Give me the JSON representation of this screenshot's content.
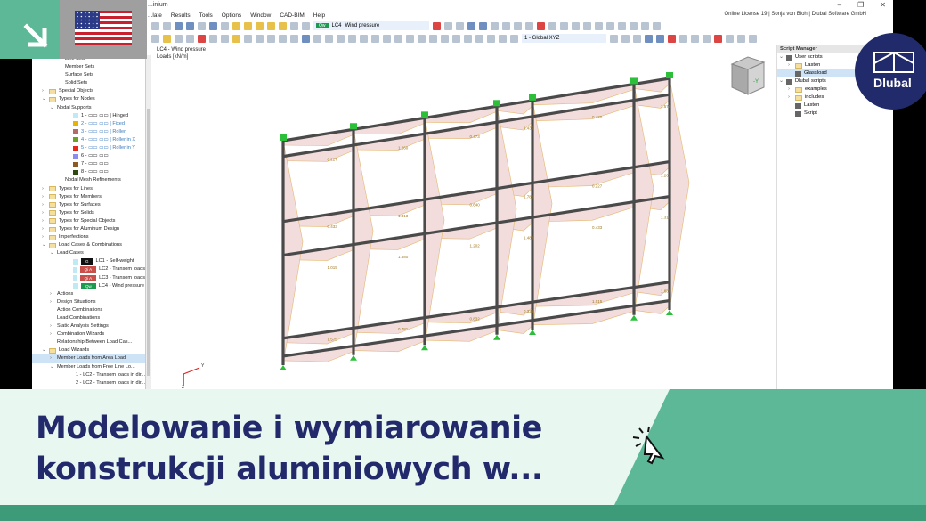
{
  "app": {
    "title": "...inium",
    "license": "Online License 19 | Sonja von Bloh | Dlubal Software GmbH",
    "menu": [
      "...late",
      "Results",
      "Tools",
      "Options",
      "Window",
      "CAD-BIM",
      "Help"
    ],
    "window_controls": [
      "–",
      "❐",
      "✕"
    ]
  },
  "toolbar": {
    "load_case_badge": "Qw",
    "load_case_id": "LC4",
    "load_case_name": "Wind pressure",
    "coord_system": "1 - Global XYZ"
  },
  "view": {
    "title": "LC4 - Wind pressure",
    "units": "Loads [kN/m]",
    "cube_label": "-Y",
    "axis_y": "Y",
    "axis_z": "Z"
  },
  "tree": [
    {
      "label": "Line Sets",
      "indent": 3
    },
    {
      "label": "Member Sets",
      "indent": 3
    },
    {
      "label": "Surface Sets",
      "indent": 3
    },
    {
      "label": "Solid Sets",
      "indent": 3
    },
    {
      "label": "Special Objects",
      "indent": 1,
      "folder": true,
      "arrow": ">"
    },
    {
      "label": "Types for Nodes",
      "indent": 1,
      "folder": true,
      "arrow": "v"
    },
    {
      "label": "Nodal Supports",
      "indent": 2,
      "arrow": "v"
    },
    {
      "label": "1 - ▭▭ ▭▭ | Hinged",
      "indent": 4,
      "color": "#bfeaf5"
    },
    {
      "label": "2 - ▭▭ ▭▭ | Fixed",
      "indent": 4,
      "color": "#e8b400",
      "blue": true
    },
    {
      "label": "3 - ▭▭ ▭▭ | Roller",
      "indent": 4,
      "color": "#b56b66",
      "blue": true
    },
    {
      "label": "4 - ▭▭ ▭▭ | Roller in X",
      "indent": 4,
      "color": "#6aa31f",
      "blue": true
    },
    {
      "label": "5 - ▭▭ ▭▭ | Roller in Y",
      "indent": 4,
      "color": "#e8261a",
      "blue": true
    },
    {
      "label": "6 - ▭▭ ▭▭",
      "indent": 4,
      "color": "#8c8cf0"
    },
    {
      "label": "7 - ▭▭ ▭▭",
      "indent": 4,
      "color": "#8b5a25"
    },
    {
      "label": "8 - ▭▭ ▭▭",
      "indent": 4,
      "color": "#2f4a10"
    },
    {
      "label": "Nodal Mesh Refinements",
      "indent": 3
    },
    {
      "label": "Types for Lines",
      "indent": 1,
      "folder": true,
      "arrow": ">"
    },
    {
      "label": "Types for Members",
      "indent": 1,
      "folder": true,
      "arrow": ">"
    },
    {
      "label": "Types for Surfaces",
      "indent": 1,
      "folder": true,
      "arrow": ">"
    },
    {
      "label": "Types for Solids",
      "indent": 1,
      "folder": true,
      "arrow": ">"
    },
    {
      "label": "Types for Special Objects",
      "indent": 1,
      "folder": true,
      "arrow": ">"
    },
    {
      "label": "Types for Aluminum Design",
      "indent": 1,
      "folder": true,
      "arrow": ">"
    },
    {
      "label": "Imperfections",
      "indent": 1,
      "folder": true,
      "arrow": ">"
    },
    {
      "label": "Load Cases & Combinations",
      "indent": 1,
      "folder": true,
      "arrow": "v"
    },
    {
      "label": "Load Cases",
      "indent": 2,
      "arrow": "v"
    },
    {
      "label": "LC1 - Self-weight",
      "indent": 4,
      "badge": "G",
      "badgeColor": "#111"
    },
    {
      "label": "LC2 - Transom loads",
      "indent": 4,
      "badge": "Qi A",
      "badgeColor": "#c9504a"
    },
    {
      "label": "LC3 - Transom loads",
      "indent": 4,
      "badge": "Qi A",
      "badgeColor": "#c9504a"
    },
    {
      "label": "LC4 - Wind pressure",
      "indent": 4,
      "badge": "Qw",
      "badgeColor": "#1c9a4f"
    },
    {
      "label": "Actions",
      "indent": 2,
      "arrow": ">"
    },
    {
      "label": "Design Situations",
      "indent": 2,
      "arrow": ">"
    },
    {
      "label": "Action Combinations",
      "indent": 2
    },
    {
      "label": "Load Combinations",
      "indent": 2
    },
    {
      "label": "Static Analysis Settings",
      "indent": 2,
      "arrow": ">"
    },
    {
      "label": "Combination Wizards",
      "indent": 2,
      "arrow": ">"
    },
    {
      "label": "Relationship Between Load Cas...",
      "indent": 2
    },
    {
      "label": "Load Wizards",
      "indent": 1,
      "folder": true,
      "arrow": "v"
    },
    {
      "label": "Member Loads from Area Load",
      "indent": 2,
      "arrow": ">",
      "selected": true
    },
    {
      "label": "Member Loads from Free Line Lo...",
      "indent": 2,
      "arrow": "v"
    },
    {
      "label": "1 - LC2 - Transom loads in dir...",
      "indent": 4,
      "color": "#bfeaf5"
    },
    {
      "label": "2 - LC2 - Transom loads in dir...",
      "indent": 4,
      "color": "#e8b400"
    }
  ],
  "script_manager": {
    "title": "Script Manager",
    "items": [
      {
        "label": "User scripts",
        "indent": 0,
        "arrow": "v",
        "type": "script"
      },
      {
        "label": "Lasten",
        "indent": 1,
        "arrow": ">",
        "type": "folder"
      },
      {
        "label": "Glassload",
        "indent": 1,
        "type": "script",
        "selected": true
      },
      {
        "label": "Dlubal scripts",
        "indent": 0,
        "arrow": "v",
        "type": "script"
      },
      {
        "label": "examples",
        "indent": 1,
        "arrow": ">",
        "type": "folder"
      },
      {
        "label": "includes",
        "indent": 1,
        "arrow": ">",
        "type": "folder"
      },
      {
        "label": "Lasten",
        "indent": 1,
        "type": "script"
      },
      {
        "label": "Skript",
        "indent": 1,
        "type": "script"
      }
    ]
  },
  "load_values": [
    "0.227",
    "0.433",
    "1.015",
    "1.575",
    "1.260",
    "1.313",
    "1.680",
    "0.781",
    "0.473",
    "0.640",
    "1.202",
    "0.832",
    "1.435",
    "1.780",
    "1.488",
    "0.328",
    "0.420"
  ],
  "brand": {
    "logo_text": "Dlubal",
    "accent": "#5cb896",
    "navy": "#212a6b"
  },
  "banner": {
    "line1": "Modelowanie i wymiarowanie",
    "line2": "konstrukcji aluminiowych w..."
  }
}
